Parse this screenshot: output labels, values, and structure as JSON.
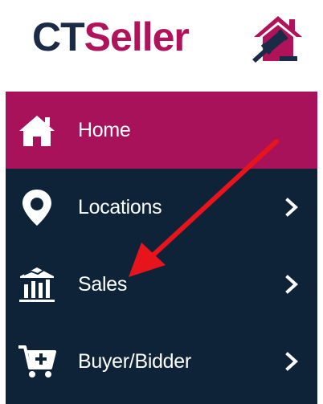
{
  "brand": {
    "prefix": "CT",
    "suffix": "Seller",
    "prefix_color": "#1b2a47",
    "suffix_color": "#b0135a",
    "mark_icon": "gavel-house-icon"
  },
  "sidebar": {
    "background_color": "#0e2338",
    "active_color": "#a8125a",
    "items": [
      {
        "label": "Home",
        "icon": "home-icon",
        "active": true,
        "has_submenu": false
      },
      {
        "label": "Locations",
        "icon": "map-pin-icon",
        "active": false,
        "has_submenu": true
      },
      {
        "label": "Sales",
        "icon": "bar-chart-icon",
        "active": false,
        "has_submenu": true
      },
      {
        "label": "Buyer/Bidder",
        "icon": "cart-icon",
        "active": false,
        "has_submenu": true
      }
    ]
  },
  "annotation": {
    "icon": "red-arrow-icon",
    "color": "#e8141c"
  }
}
